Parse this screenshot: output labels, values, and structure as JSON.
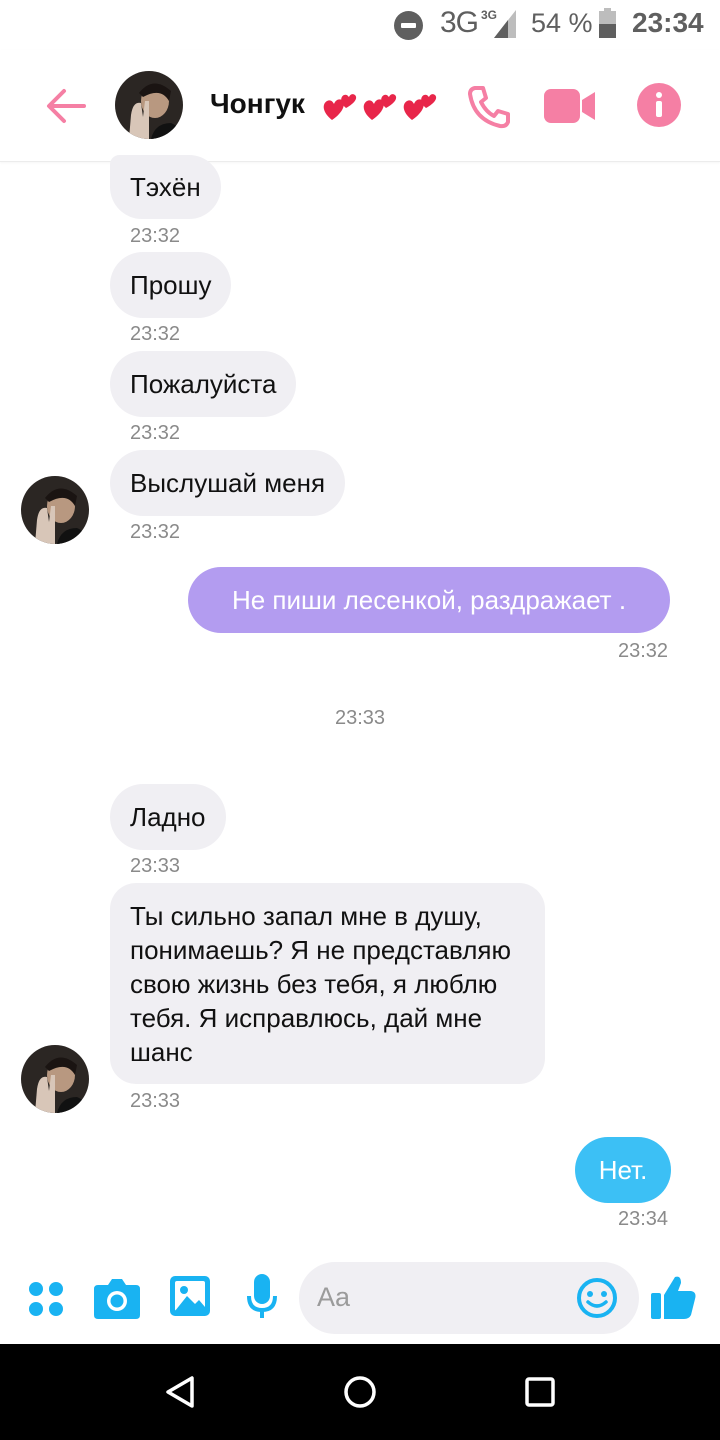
{
  "status_bar": {
    "network": "3G",
    "network_small": "3G",
    "battery": "54 %",
    "time": "23:34"
  },
  "header": {
    "contact_name": "Чонгук",
    "accent_color": "#f57fa4"
  },
  "messages": [
    {
      "text": "Тэхён",
      "time": "23:32",
      "direction": "incoming"
    },
    {
      "text": "Прошу",
      "time": "23:32",
      "direction": "incoming"
    },
    {
      "text": "Пожалуйста",
      "time": "23:32",
      "direction": "incoming"
    },
    {
      "text": "Выслушай меня",
      "time": "23:32",
      "direction": "incoming"
    },
    {
      "text": "Не пиши лесенкой, раздражает .",
      "time": "23:32",
      "direction": "outgoing",
      "color": "#b39cf0"
    },
    {
      "divider_time": "23:33"
    },
    {
      "text": "Ладно",
      "time": "23:33",
      "direction": "incoming"
    },
    {
      "text": "Ты сильно запал мне в душу, понимаешь? Я не представляю свою жизнь без тебя, я люблю тебя. Я исправлюсь, дай мне шанс",
      "time": "23:33",
      "direction": "incoming"
    },
    {
      "text": "Нет.",
      "time": "23:34",
      "direction": "outgoing",
      "color": "#3cc0f5"
    }
  ],
  "composer": {
    "placeholder": "Aa",
    "icon_color": "#19b3f2"
  }
}
